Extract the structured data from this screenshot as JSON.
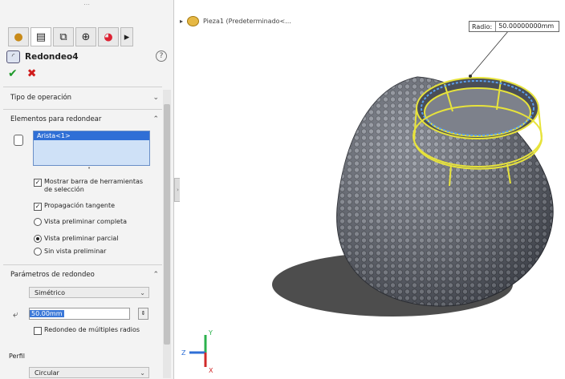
{
  "property_manager": {
    "title": "Redondeo4",
    "help_icon": "help-icon",
    "ok_icon": "check-icon",
    "cancel_icon": "x-icon",
    "tab_icons": [
      "feature-tree-icon",
      "property-manager-icon",
      "configuration-icon",
      "dimxpert-icon",
      "appearance-icon",
      "more-icon"
    ],
    "section_operation": "Tipo de operación",
    "section_elements": "Elementos para redondear",
    "selected_item": "Arista<1>",
    "show_selection_toolbar": "Mostrar barra de herramientas de selección",
    "tangent_propagation": "Propagación tangente",
    "preview_full": "Vista preliminar completa",
    "preview_partial": "Vista preliminar parcial",
    "preview_none": "Sin vista preliminar",
    "section_params": "Parámetros de redondeo",
    "symmetry": "Simétrico",
    "radius_value": "50.00mm",
    "multi_radius": "Redondeo de múltiples radios",
    "section_profile": "Perfil",
    "profile_value": "Circular"
  },
  "viewport": {
    "tree_label": "Pieza1 (Predeterminado<...",
    "radius_label": "Radio:",
    "radius_callout": "50.00000000mm",
    "axis_labels": {
      "x": "Z",
      "y": "Y",
      "z": "X"
    }
  },
  "colors": {
    "selection_yellow": "#e7e33b",
    "model_gray": "#6a6f7b",
    "accept_green": "#1e9a2a",
    "cancel_red": "#d01c1c",
    "highlight_blue": "#2f6fd6"
  }
}
